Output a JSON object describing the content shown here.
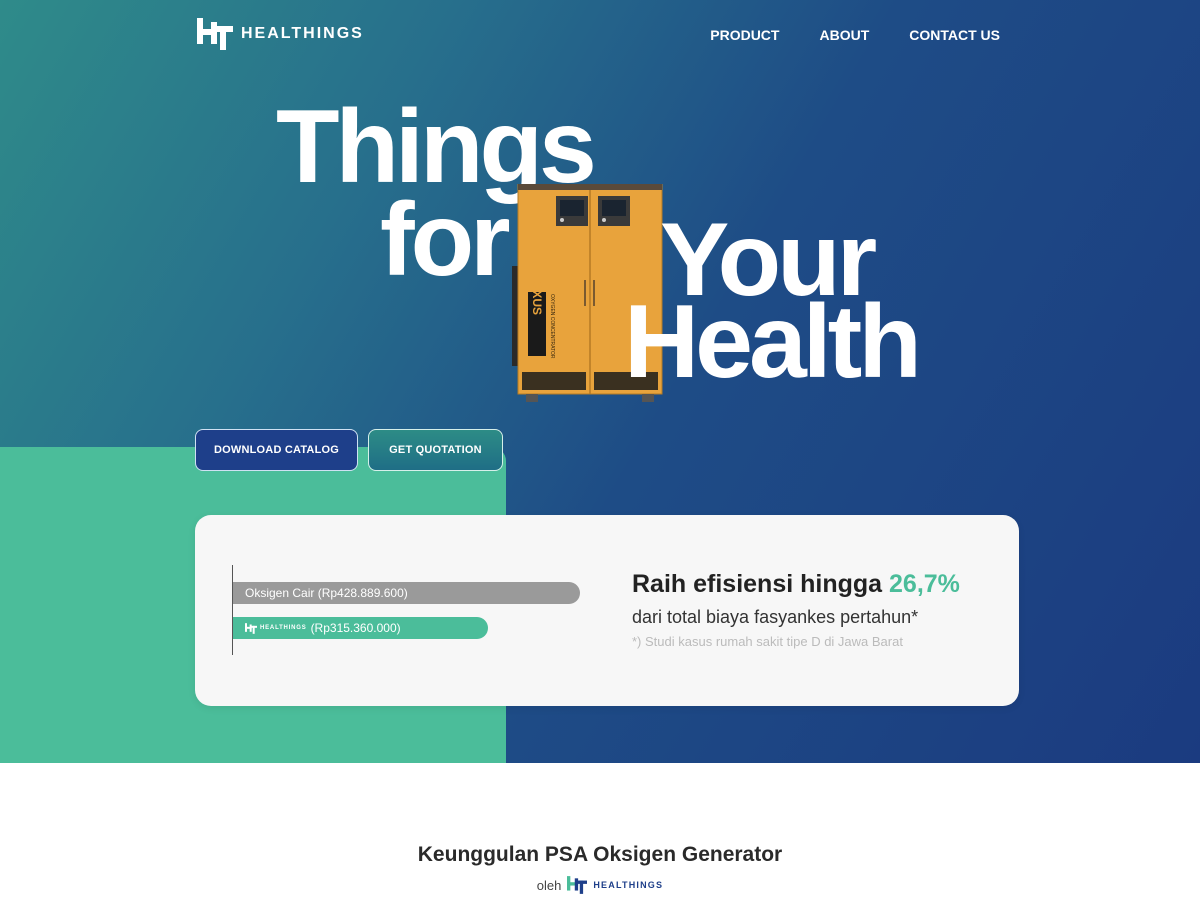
{
  "brand": {
    "name": "HEALTHINGS"
  },
  "nav": {
    "items": [
      "PRODUCT",
      "ABOUT",
      "CONTACT US"
    ]
  },
  "hero": {
    "headline": [
      "Things",
      "for",
      "Your",
      "Health"
    ],
    "device_label": "OXUS",
    "device_sublabel": "OXYGEN CONCENTRATOR"
  },
  "buttons": {
    "download": "DOWNLOAD CATALOG",
    "quotation": "GET QUOTATION"
  },
  "comparison": {
    "bars": [
      {
        "label": "Oksigen Cair (Rp428.889.600)",
        "value": 428889600,
        "color": "#9a9a9a"
      },
      {
        "label": "(Rp315.360.000)",
        "value": 315360000,
        "color": "#4bbd9a",
        "brand": "HEALTHINGS"
      }
    ],
    "title_prefix": "Raih efisiensi hingga",
    "title_value": "26,7%",
    "subtitle": "dari total biaya fasyankes pertahun*",
    "note": "*) Studi kasus rumah sakit tipe D di Jawa Barat"
  },
  "section": {
    "title": "Keunggulan PSA Oksigen Generator",
    "by_prefix": "oleh",
    "by_brand": "HEALTHINGS"
  },
  "colors": {
    "accent_green": "#4bbd9a",
    "navy": "#1e3f8a",
    "machine_orange": "#e8a33c"
  }
}
